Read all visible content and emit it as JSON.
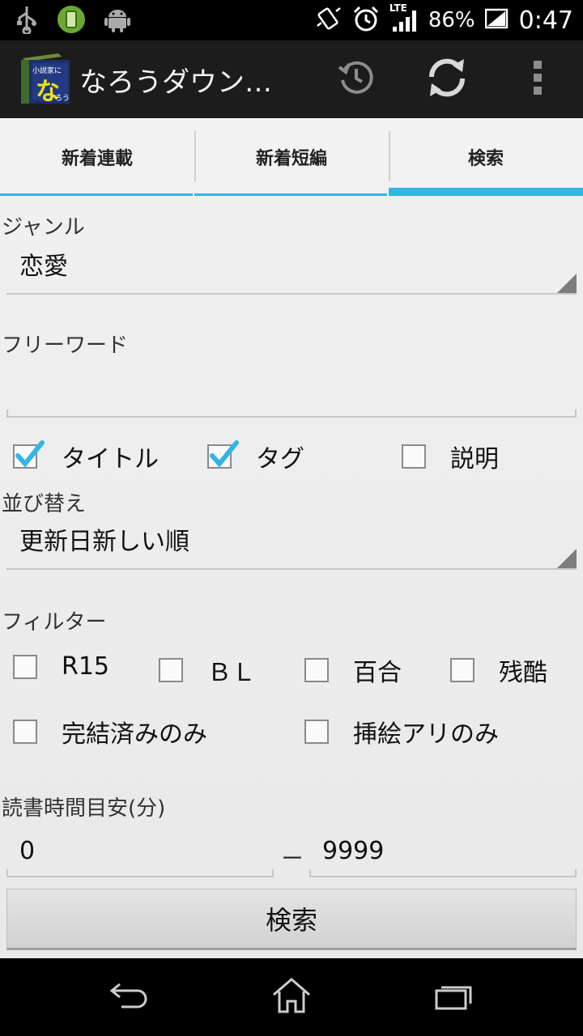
{
  "status_bar": {
    "network_label": "LTE",
    "battery_percent": "86%",
    "time": "0:47"
  },
  "action_bar": {
    "title": "なろうダウン…",
    "icon_text_top": "小説家に",
    "icon_text_main": "な",
    "icon_text_sub": "ろう"
  },
  "tabs": [
    {
      "label": "新着連載",
      "active": false
    },
    {
      "label": "新着短編",
      "active": false
    },
    {
      "label": "検索",
      "active": true
    }
  ],
  "genre": {
    "label": "ジャンル",
    "value": "恋愛"
  },
  "freeword": {
    "label": "フリーワード",
    "value": ""
  },
  "search_targets": [
    {
      "label": "タイトル",
      "checked": true
    },
    {
      "label": "タグ",
      "checked": true
    },
    {
      "label": "説明",
      "checked": false
    }
  ],
  "sort": {
    "label": "並び替え",
    "value": "更新日新しい順"
  },
  "filter": {
    "label": "フィルター",
    "row1": [
      {
        "label": "R15",
        "checked": false
      },
      {
        "label": "ＢＬ",
        "checked": false
      },
      {
        "label": "百合",
        "checked": false
      },
      {
        "label": "残酷",
        "checked": false
      }
    ],
    "row2": [
      {
        "label": "完結済みのみ",
        "checked": false
      },
      {
        "label": "挿絵アリのみ",
        "checked": false
      }
    ]
  },
  "reading_time": {
    "label": "読書時間目安(分)",
    "min": "0",
    "separator": "－",
    "max": "9999"
  },
  "search_button": {
    "label": "検索"
  },
  "colors": {
    "accent": "#33b5e5",
    "action_bar": "#1c1c1c",
    "check": "#33b5e5"
  }
}
